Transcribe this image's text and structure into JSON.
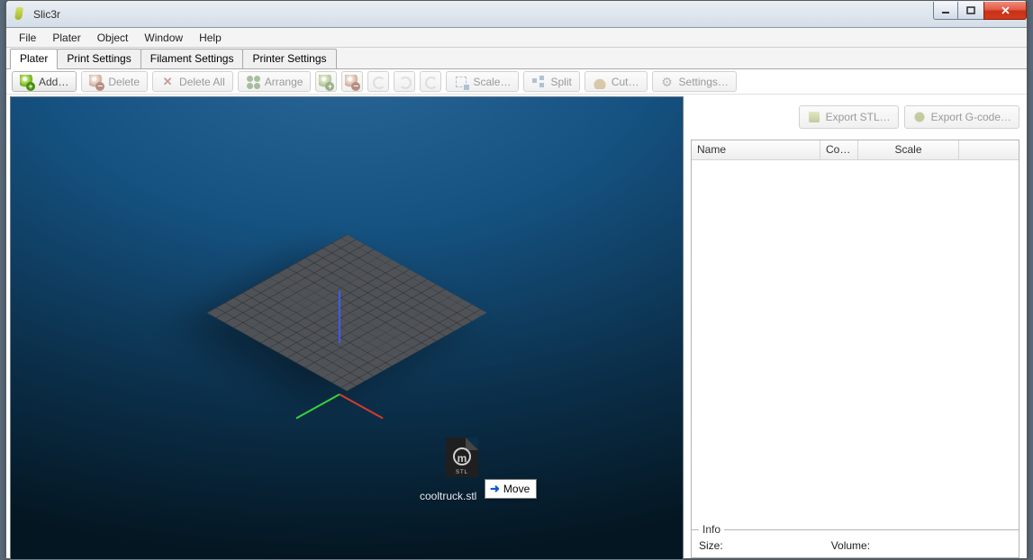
{
  "window": {
    "title": "Slic3r"
  },
  "menu": {
    "file": "File",
    "plater": "Plater",
    "object": "Object",
    "window": "Window",
    "help": "Help"
  },
  "tabs": {
    "plater": "Plater",
    "print": "Print Settings",
    "filament": "Filament Settings",
    "printer": "Printer Settings"
  },
  "toolbar": {
    "add": "Add…",
    "delete": "Delete",
    "delete_all": "Delete All",
    "arrange": "Arrange",
    "scale": "Scale…",
    "split": "Split",
    "cut": "Cut…",
    "settings": "Settings…"
  },
  "export": {
    "stl": "Export STL…",
    "gcode": "Export G-code…"
  },
  "list": {
    "col_name": "Name",
    "col_copies": "Cop…",
    "col_scale": "Scale"
  },
  "drag": {
    "file_glyph": "m",
    "file_ext": "STL",
    "filename": "cooltruck.stl",
    "tooltip": "Move"
  },
  "info": {
    "title": "Info",
    "size_label": "Size:",
    "size_value": "",
    "volume_label": "Volume:",
    "volume_value": ""
  }
}
